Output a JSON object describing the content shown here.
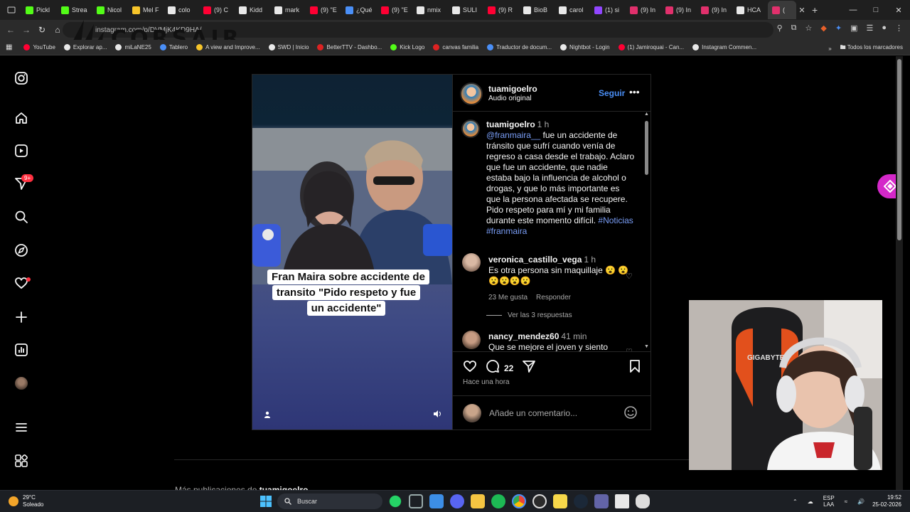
{
  "browser": {
    "tabs": [
      {
        "label": "Pickl",
        "color": "#53fc18"
      },
      {
        "label": "Strea",
        "color": "#53fc18"
      },
      {
        "label": "Nicol",
        "color": "#53fc18"
      },
      {
        "label": "Mel F",
        "color": "#f7c52a"
      },
      {
        "label": "colo",
        "color": "#e8e8e8"
      },
      {
        "label": "(9) C",
        "color": "#ff0033"
      },
      {
        "label": "Kidd",
        "color": "#e8e8e8"
      },
      {
        "label": "mark",
        "color": "#e8e8e8"
      },
      {
        "label": "(9) \"E",
        "color": "#ff0033"
      },
      {
        "label": "¿Qué",
        "color": "#4a8ff7"
      },
      {
        "label": "(9) \"E",
        "color": "#ff0033"
      },
      {
        "label": "nmix",
        "color": "#e8e8e8"
      },
      {
        "label": "SULI",
        "color": "#e8e8e8"
      },
      {
        "label": "(9) R",
        "color": "#ff0033"
      },
      {
        "label": "BioB",
        "color": "#e8e8e8"
      },
      {
        "label": "carol",
        "color": "#e8e8e8"
      },
      {
        "label": "(1) si",
        "color": "#9146ff"
      },
      {
        "label": "(9) In",
        "color": "#e1306c"
      },
      {
        "label": "(9) In",
        "color": "#e1306c"
      },
      {
        "label": "(9) In",
        "color": "#e1306c"
      },
      {
        "label": "HCA",
        "color": "#e8e8e8"
      }
    ],
    "active_tab": {
      "label": "(",
      "color": "#e1306c"
    },
    "url": "instagram.com/p/DVMjK4KD9HA/",
    "brand_overlay": "CORSAIR",
    "bookmarks": [
      {
        "label": "YouTube",
        "color": "#ff0033"
      },
      {
        "label": "Explorar ap...",
        "color": "#e8e8e8"
      },
      {
        "label": "miLaNE25",
        "color": "#e8e8e8"
      },
      {
        "label": "Tablero",
        "color": "#4a8ff7"
      },
      {
        "label": "A view and Improve...",
        "color": "#f7c52a"
      },
      {
        "label": "SWD | Inicio",
        "color": "#e8e8e8"
      },
      {
        "label": "BetterTTV - Dashbo...",
        "color": "#d22"
      },
      {
        "label": "Kick Logo",
        "color": "#53fc18"
      },
      {
        "label": "canvas familia",
        "color": "#d22"
      },
      {
        "label": "Traductor de docum...",
        "color": "#4a8ff7"
      },
      {
        "label": "Nightbot - Login",
        "color": "#e8e8e8"
      },
      {
        "label": "(1) Jamiroquai - Can...",
        "color": "#ff0033"
      },
      {
        "label": "Instagram Commen...",
        "color": "#e8e8e8"
      }
    ],
    "all_bookmarks": "Todos los marcadores"
  },
  "sidebar": {
    "notifications_badge": "9+"
  },
  "post": {
    "username": "tuamigoelro",
    "audio": "Audio original",
    "follow_label": "Seguir",
    "video_caption": "Fran Maira sobre accidente de transito \"Pido respeto y fue un accidente\"",
    "caption": {
      "username": "tuamigoelro",
      "time": "1 h",
      "mention": "@franmaira__",
      "text": "  fue un accidente de tránsito que sufrí cuando venía de regreso a casa desde el trabajo. Aclaro que fue un accidente, que nadie estaba bajo la influencia de alcohol o drogas, y que lo más importante es que la persona afectada se recupere. Pido respeto para mí y mi familia durante este momento difícil.",
      "tag1": "#Noticias",
      "tag2": "#franmaira"
    },
    "comments": [
      {
        "username": "veronica_castillo_vega",
        "time": "1 h",
        "text": "Es otra persona sin maquillaje 😮 😮😮😮😮😮",
        "likes": "23 Me gusta",
        "reply": "Responder",
        "view_replies": "Ver las 3 respuestas"
      },
      {
        "username": "nancy_mendez60",
        "time": "41 min",
        "text": "Que se mejore el joven y siento"
      }
    ],
    "comment_count": "22",
    "posted": "Hace una hora",
    "add_comment_placeholder": "Añade un comentario..."
  },
  "more_posts": {
    "prefix": "Más publicaciones de ",
    "username": "tuamigoelro"
  },
  "taskbar": {
    "temperature": "29°C",
    "weather": "Soleado",
    "search_placeholder": "Buscar",
    "language": "ESP",
    "language_sub": "LAA",
    "time": "19:52",
    "date": "25-02-2026"
  },
  "colors": {
    "accent_blue": "#4a8ff7",
    "badge_red": "#ff3040",
    "float_button": "#d428c9"
  }
}
